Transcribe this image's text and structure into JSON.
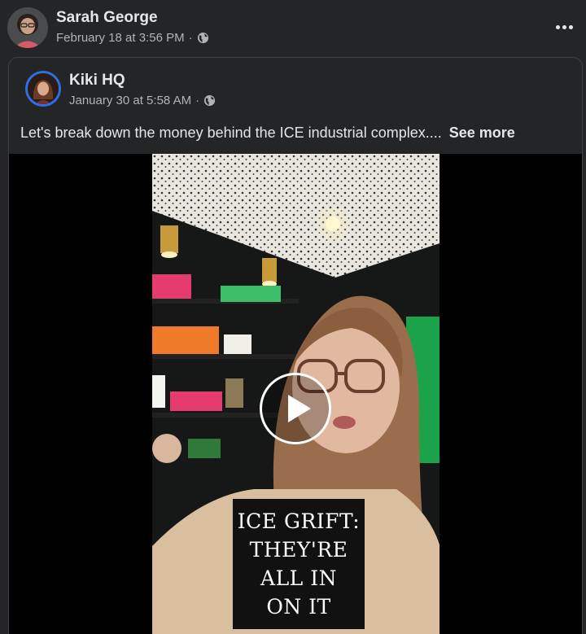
{
  "post": {
    "author": "Sarah George",
    "timestamp": "February 18 at 3:56 PM",
    "separator": "·",
    "privacy_icon": "globe-icon",
    "more_icon": "more-options-icon"
  },
  "shared_post": {
    "author": "Kiki HQ",
    "timestamp": "January 30 at 5:58 AM",
    "separator": "·",
    "privacy_icon": "globe-icon",
    "text": "Let's break down the money behind the ICE industrial complex....",
    "see_more": "See more"
  },
  "video": {
    "play_icon": "play-icon",
    "caption_lines": [
      "ICE GRIFT:",
      "THEY'RE",
      "ALL IN",
      "ON IT"
    ]
  },
  "colors": {
    "background": "#242526",
    "text_primary": "#e4e6eb",
    "text_secondary": "#b0b3b8",
    "avatar_ring": "#2d6fe8",
    "video_bg": "#000000"
  }
}
